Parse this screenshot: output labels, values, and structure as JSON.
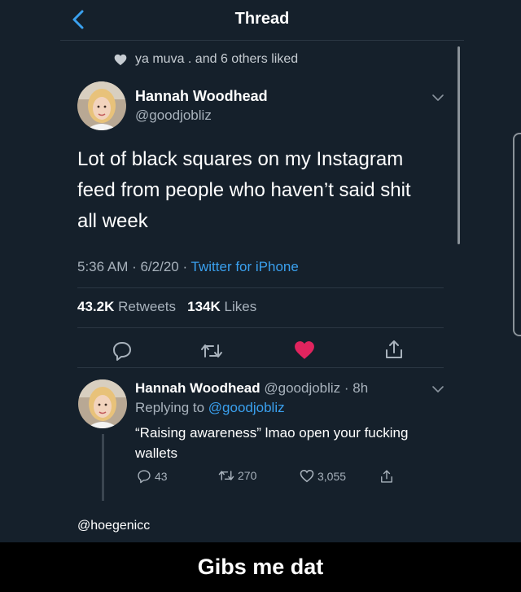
{
  "header": {
    "title": "Thread",
    "back_icon": "chevron-left-icon"
  },
  "social_context": {
    "text": "ya muva . and 6 others liked",
    "icon": "heart-icon"
  },
  "tweet": {
    "author_name": "Hannah Woodhead",
    "author_handle": "@goodjobliz",
    "text": "Lot of black squares on my Instagram feed from people who haven’t said shit all week",
    "time": "5:36 AM · 6/2/20 · ",
    "source": "Twitter for iPhone",
    "retweets_count": "43.2K",
    "retweets_label": " Retweets",
    "likes_count": "134K",
    "likes_label": " Likes",
    "liked": true
  },
  "reply": {
    "author_name": "Hannah Woodhead",
    "author_meta": " @goodjobliz · 8h",
    "replying_prefix": "Replying to ",
    "replying_handle": "@goodjobliz",
    "text": "“Raising awareness” lmao open your fucking wallets",
    "replies": "43",
    "retweets": "270",
    "likes": "3,055"
  },
  "credit": "@hoegenicc",
  "caption": "Gibs me dat",
  "colors": {
    "background": "#15202b",
    "accent_blue": "#3aa0ee",
    "like_red": "#e0245e",
    "muted_text": "#a8b2bc"
  }
}
